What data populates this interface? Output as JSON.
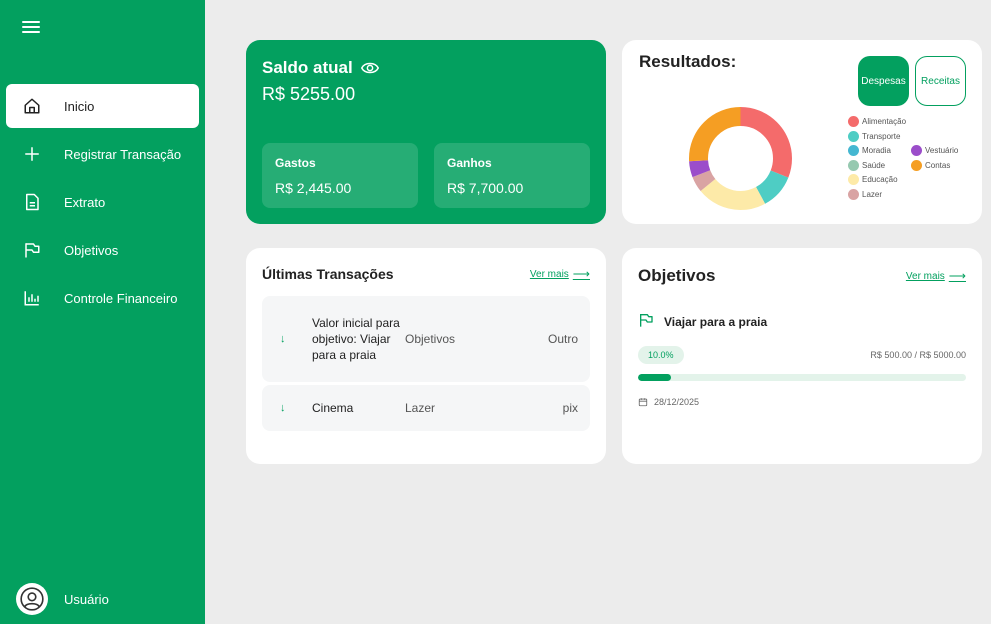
{
  "sidebar": {
    "items": [
      {
        "label": "Inicio",
        "icon": "home-icon"
      },
      {
        "label": "Registrar Transação",
        "icon": "plus-icon"
      },
      {
        "label": "Extrato",
        "icon": "document-icon"
      },
      {
        "label": "Objetivos",
        "icon": "flag-icon"
      },
      {
        "label": "Controle Financeiro",
        "icon": "bar-chart-icon"
      }
    ],
    "user_label": "Usuário"
  },
  "balance": {
    "title": "Saldo atual",
    "amount": "R$ 5255.00",
    "expenses_label": "Gastos",
    "expenses_value": "R$ 2,445.00",
    "income_label": "Ganhos",
    "income_value": "R$ 7,700.00"
  },
  "results": {
    "title": "Resultados:",
    "expenses_button": "Despesas",
    "income_button": "Receitas",
    "legend": [
      {
        "name": "Alimentação",
        "color": "#f46b6b"
      },
      {
        "name": "Transporte",
        "color": "#4ecdc4"
      },
      {
        "name": "Moradia",
        "color": "#45b7d1"
      },
      {
        "name": "Vestuário",
        "color": "#9b4dca"
      },
      {
        "name": "Saúde",
        "color": "#96c9b0"
      },
      {
        "name": "Contas",
        "color": "#f59e23"
      },
      {
        "name": "Educação",
        "color": "#fdeaa8"
      },
      {
        "name": "Lazer",
        "color": "#d9a3a3"
      }
    ]
  },
  "chart_data": {
    "type": "pie",
    "categories": [
      "Alimentação",
      "Transporte",
      "Educação",
      "Lazer",
      "Vestuário",
      "Contas"
    ],
    "values": [
      31,
      11,
      22,
      5,
      5,
      26
    ],
    "colors": [
      "#f46b6b",
      "#4ecdc4",
      "#fdeaa8",
      "#d9a3a3",
      "#9b4dca",
      "#f59e23"
    ]
  },
  "transactions": {
    "title": "Últimas Transações",
    "see_more": "Ver mais",
    "rows": [
      {
        "description": "Valor inicial para objetivo: Viajar para a praia",
        "category": "Objetivos",
        "method": "Outro"
      },
      {
        "description": "Cinema",
        "category": "Lazer",
        "method": "pix"
      }
    ]
  },
  "goals": {
    "title": "Objetivos",
    "see_more": "Ver mais",
    "item": {
      "name": "Viajar para a praia",
      "percent": "10.0%",
      "progress": 0.1,
      "amount": "R$ 500.00 / R$ 5000.00",
      "date": "28/12/2025"
    }
  },
  "colors": {
    "brand": "#03a05f",
    "background": "#ececec"
  }
}
